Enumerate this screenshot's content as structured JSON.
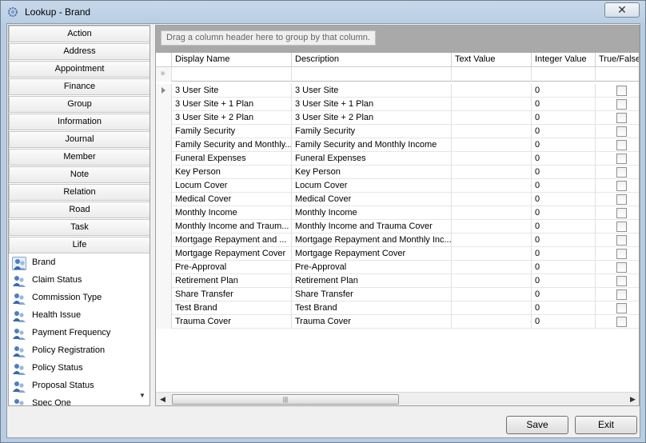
{
  "window": {
    "title": "Lookup - Brand",
    "close_label": "✕"
  },
  "categories": [
    "Action",
    "Address",
    "Appointment",
    "Finance",
    "Group",
    "Information",
    "Journal",
    "Member",
    "Note",
    "Relation",
    "Road",
    "Task",
    "Life"
  ],
  "life_items": [
    "Brand",
    "Claim Status",
    "Commission Type",
    "Health Issue",
    "Payment Frequency",
    "Policy Registration",
    "Policy Status",
    "Proposal Status",
    "Spec One"
  ],
  "selected_item": "Brand",
  "grid": {
    "group_hint": "Drag a column header here to group by that column.",
    "columns": [
      "Display Name",
      "Description",
      "Text Value",
      "Integer Value",
      "True/False"
    ],
    "rows": [
      {
        "display": "3 User Site",
        "description": "3 User Site",
        "text": "",
        "integer": "0",
        "bool": false
      },
      {
        "display": "3 User Site + 1 Plan",
        "description": "3 User Site + 1 Plan",
        "text": "",
        "integer": "0",
        "bool": false
      },
      {
        "display": "3 User Site + 2 Plan",
        "description": "3 User Site + 2 Plan",
        "text": "",
        "integer": "0",
        "bool": false
      },
      {
        "display": "Family Security",
        "description": "Family Security",
        "text": "",
        "integer": "0",
        "bool": false
      },
      {
        "display": "Family Security and Monthly...",
        "description": "Family Security and Monthly Income",
        "text": "",
        "integer": "0",
        "bool": false
      },
      {
        "display": "Funeral Expenses",
        "description": "Funeral Expenses",
        "text": "",
        "integer": "0",
        "bool": false
      },
      {
        "display": "Key Person",
        "description": "Key Person",
        "text": "",
        "integer": "0",
        "bool": false
      },
      {
        "display": "Locum Cover",
        "description": "Locum Cover",
        "text": "",
        "integer": "0",
        "bool": false
      },
      {
        "display": "Medical Cover",
        "description": "Medical Cover",
        "text": "",
        "integer": "0",
        "bool": false
      },
      {
        "display": "Monthly Income",
        "description": "Monthly Income",
        "text": "",
        "integer": "0",
        "bool": false
      },
      {
        "display": "Monthly Income and Traum...",
        "description": "Monthly Income and Trauma Cover",
        "text": "",
        "integer": "0",
        "bool": false
      },
      {
        "display": "Mortgage Repayment and ...",
        "description": "Mortgage Repayment and Monthly Inc...",
        "text": "",
        "integer": "0",
        "bool": false
      },
      {
        "display": "Mortgage Repayment Cover",
        "description": "Mortgage Repayment Cover",
        "text": "",
        "integer": "0",
        "bool": false
      },
      {
        "display": "Pre-Approval",
        "description": "Pre-Approval",
        "text": "",
        "integer": "0",
        "bool": false
      },
      {
        "display": "Retirement Plan",
        "description": "Retirement Plan",
        "text": "",
        "integer": "0",
        "bool": false
      },
      {
        "display": "Share Transfer",
        "description": "Share Transfer",
        "text": "",
        "integer": "0",
        "bool": false
      },
      {
        "display": "Test Brand",
        "description": "Test Brand",
        "text": "",
        "integer": "0",
        "bool": false
      },
      {
        "display": "Trauma Cover",
        "description": "Trauma Cover",
        "text": "",
        "integer": "0",
        "bool": false
      }
    ],
    "scroll_thumb_glyph": "|||"
  },
  "buttons": {
    "save": "Save",
    "exit": "Exit"
  },
  "icons": {
    "window": "gear-icon",
    "list_item": "users-icon",
    "row_indicator": "current-row-arrow-icon",
    "filter": "new-row-star-icon"
  }
}
